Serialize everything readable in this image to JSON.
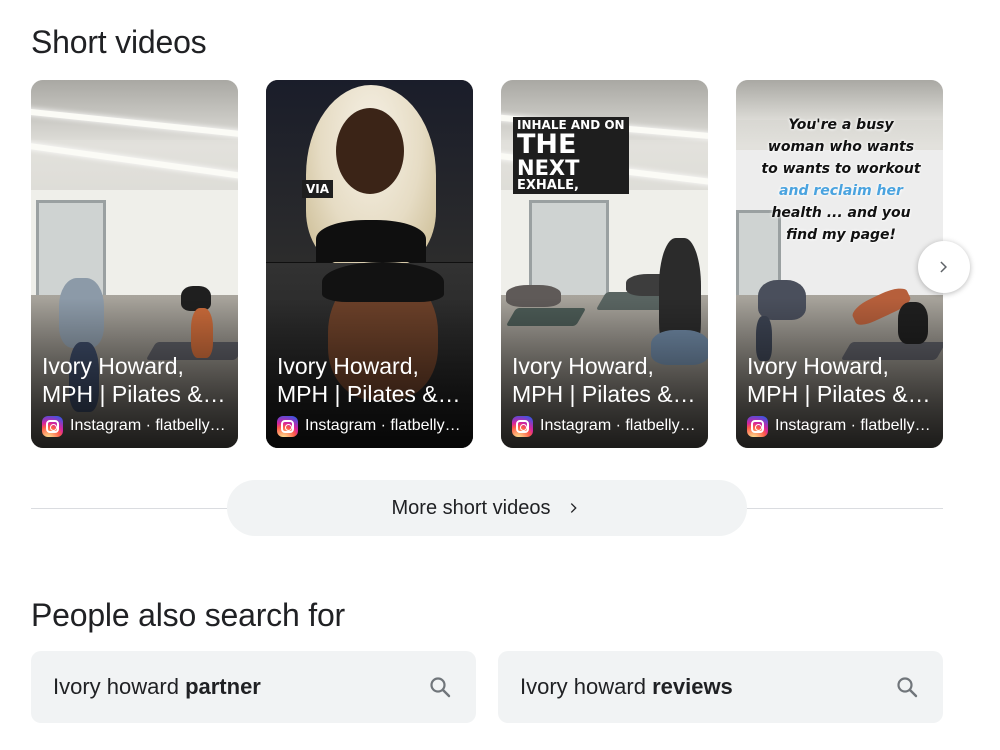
{
  "short_videos": {
    "title": "Short videos",
    "cards": [
      {
        "title": "Ivory Howard, MPH | Pilates & Fitness",
        "source": "Instagram · flatbellyfitness"
      },
      {
        "title": "Ivory Howard, MPH | Pilates & Fitness",
        "source": "Instagram · flatbellyfitness",
        "overlay_text": "VIA"
      },
      {
        "title": "Ivory Howard, MPH | Pilates & Fitness",
        "source": "Instagram · flatbellyfitness",
        "overlay_lines": [
          "INHALE AND ON",
          "THE",
          "NEXT",
          "EXHALE,"
        ]
      },
      {
        "title": "Ivory Howard, MPH | Pilates & Fitness",
        "source": "Instagram · flatbellyfitness",
        "overlay_lines": [
          "You're a busy",
          "woman who wants",
          "to wants to workout",
          "and reclaim her",
          "health ... and you",
          "find my page!"
        ]
      }
    ],
    "more_label": "More short videos"
  },
  "people_also_search": {
    "title": "People also search for",
    "items": [
      {
        "prefix": "Ivory howard ",
        "bold": "partner"
      },
      {
        "prefix": "Ivory howard ",
        "bold": "reviews"
      }
    ]
  },
  "icons": {
    "source": "instagram-icon",
    "next": "chevron-right-icon",
    "search": "search-icon"
  },
  "colors": {
    "chip_bg": "#f1f3f4",
    "text": "#202124",
    "divider": "#dadce0",
    "caption_blue": "#4aa3df"
  }
}
